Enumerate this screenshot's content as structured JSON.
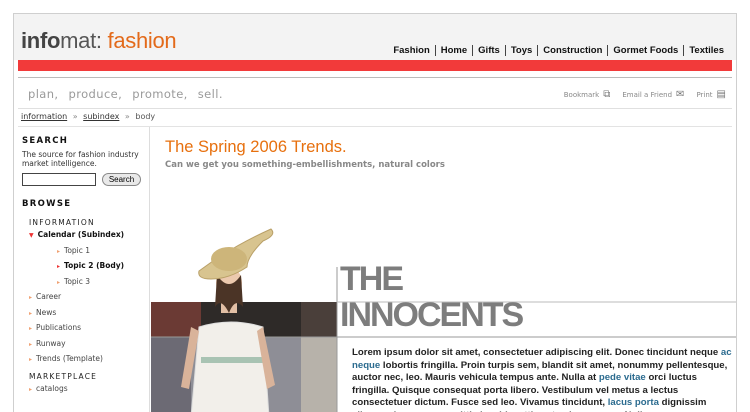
{
  "header": {
    "logo": {
      "part1": "info",
      "part2": "mat: ",
      "part3": "fashion"
    },
    "nav": [
      "Fashion",
      "Home",
      "Gifts",
      "Toys",
      "Construction",
      "Gormet Foods",
      "Textiles"
    ],
    "brand_color": "#e36a1a",
    "bar_color": "#f23a3a"
  },
  "tagline": "plan, produce, promote, sell.",
  "tools": {
    "bookmark": "Bookmark",
    "email": "Email a Friend",
    "print": "Print"
  },
  "breadcrumb": {
    "item1": "information",
    "item2": "subindex",
    "current": "body",
    "separator": "»"
  },
  "sidebar": {
    "search_heading": "SEARCH",
    "search_desc": "The source for fashion industry market intelligence.",
    "search_value": "",
    "search_button": "Search",
    "browse_heading": "BROWSE",
    "info_heading": "INFORMATION",
    "calendar": "Calendar (Subindex)",
    "topic1": "Topic 1",
    "topic2": "Topic 2 (Body)",
    "topic3": "Topic 3",
    "career": "Career",
    "news": "News",
    "publications": "Publications",
    "runway": "Runway",
    "trends": "Trends (Template)",
    "marketplace_heading": "MARKETPLACE",
    "catalogs": "catalogs"
  },
  "main": {
    "title": "The Spring 2006 Trends.",
    "subtitle": "Can we get you something-embellishments, natural colors",
    "headline1": "THE",
    "headline2": "INNOCENTS",
    "body": {
      "s1": "Lorem ipsum dolor sit amet, consectetuer adipiscing elit. Donec tincidunt neque ",
      "l1": "ac neque",
      "s2": " lobortis fringilla. Proin turpis sem, blandit sit amet, nonummy pellentesque, auctor nec, leo. Mauris vehicula tempus ante. Nulla at ",
      "l2": "pede vitae",
      "s3": " orci luctus fringilla. Quisque consequat porta libero. Vestibulum vel metus a lectus consectetuer dictum. Fusce sed leo. Vivamus tincidunt, ",
      "l3": "lacus porta",
      "s4": " dignissim aliquam, lacus eros sagittis leo, id mattis est enim a augue. Nulla"
    }
  }
}
